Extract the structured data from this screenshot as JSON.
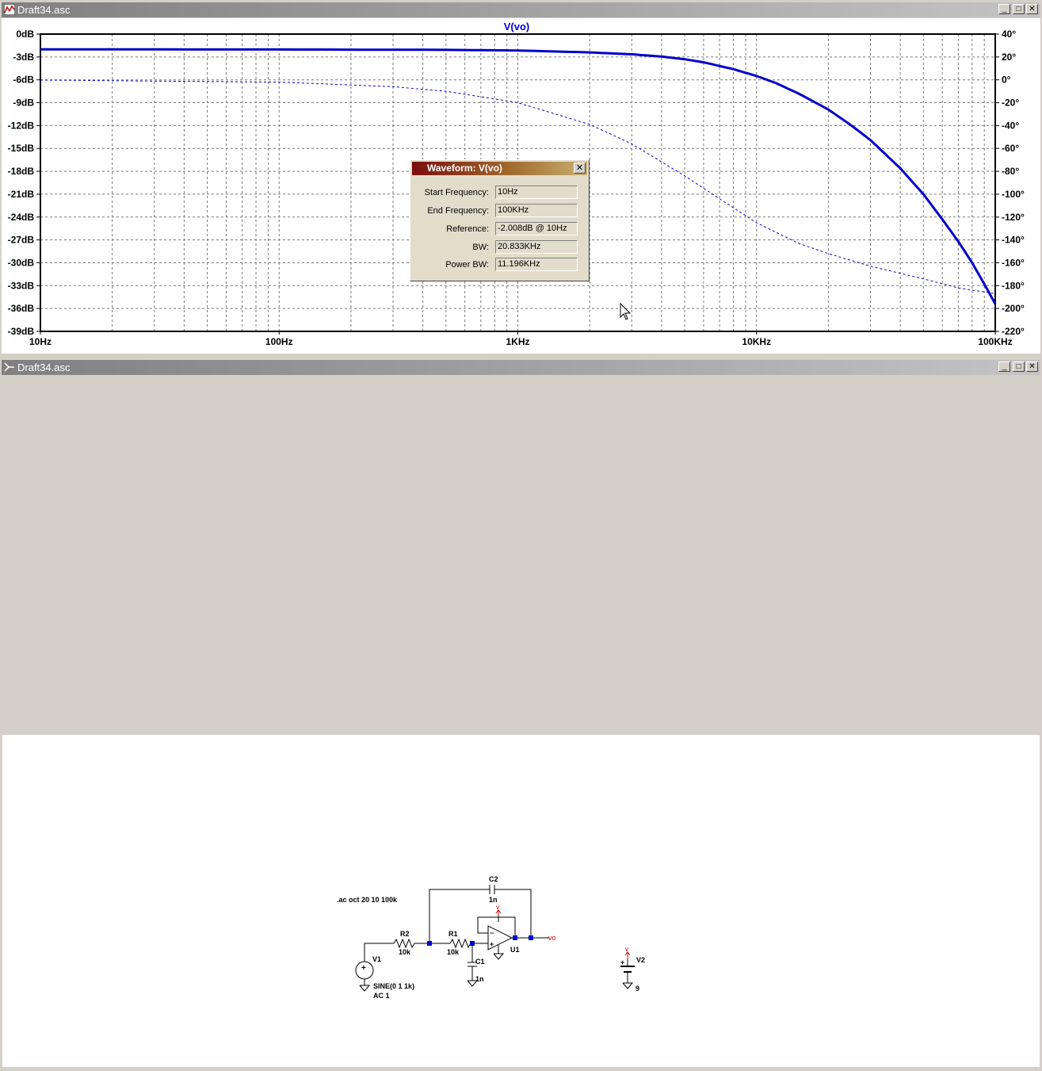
{
  "plot_window": {
    "title": "Draft34.asc",
    "trace_label": "V(vo)"
  },
  "schematic_window": {
    "title": "Draft34.asc"
  },
  "controls": {
    "minimize": "_",
    "maximize": "□",
    "close": "✕"
  },
  "chart_data": {
    "type": "line",
    "title": "V(vo)",
    "xscale": "log",
    "xlim": [
      10,
      100000
    ],
    "x_ticks": [
      "10Hz",
      "100Hz",
      "1KHz",
      "10KHz",
      "100KHz"
    ],
    "y_left_ticks": [
      "0dB",
      "-3dB",
      "-6dB",
      "-9dB",
      "-12dB",
      "-15dB",
      "-18dB",
      "-21dB",
      "-24dB",
      "-27dB",
      "-30dB",
      "-33dB",
      "-36dB",
      "-39dB"
    ],
    "ylim_left": [
      -39,
      0
    ],
    "y_right_ticks": [
      "40°",
      "20°",
      "0°",
      "-20°",
      "-40°",
      "-60°",
      "-80°",
      "-100°",
      "-120°",
      "-140°",
      "-160°",
      "-180°",
      "-200°",
      "-220°"
    ],
    "ylim_right": [
      -220,
      40
    ],
    "grid": true,
    "series": [
      {
        "style": "solid",
        "axis": "left",
        "color": "#0000cc",
        "x": [
          10,
          100,
          500,
          1000,
          2000,
          3000,
          4000,
          5000,
          6000,
          8000,
          10000,
          12000,
          15000,
          20000,
          25000,
          30000,
          40000,
          50000,
          60000,
          70000,
          80000,
          90000,
          100000
        ],
        "y": [
          -2.0,
          -2.02,
          -2.07,
          -2.15,
          -2.4,
          -2.65,
          -2.95,
          -3.3,
          -3.7,
          -4.6,
          -5.5,
          -6.4,
          -7.8,
          -9.9,
          -12.0,
          -13.9,
          -17.6,
          -21.0,
          -24.3,
          -27.2,
          -30.0,
          -32.8,
          -35.4
        ]
      },
      {
        "style": "dashed",
        "axis": "right",
        "color": "#0000cc",
        "x": [
          10,
          100,
          300,
          500,
          1000,
          2000,
          3000,
          5000,
          7000,
          10000,
          15000,
          20000,
          30000,
          50000,
          70000,
          100000
        ],
        "y": [
          -0.2,
          -2,
          -6,
          -10,
          -20,
          -39,
          -56,
          -84,
          -104,
          -125,
          -143,
          -152,
          -163,
          -174,
          -182,
          -187
        ]
      }
    ]
  },
  "dialog": {
    "title": "Waveform: V(vo)",
    "close": "✕",
    "rows": [
      {
        "label": "Start Frequency:",
        "value": "10Hz"
      },
      {
        "label": "End Frequency:",
        "value": "100KHz"
      },
      {
        "label": "Reference:",
        "value": "-2.008dB @ 10Hz"
      },
      {
        "label": "BW:",
        "value": "20.833KHz"
      },
      {
        "label": "Power BW:",
        "value": "11.196KHz"
      }
    ]
  },
  "schematic": {
    "directive": ".ac oct 20 10 100k",
    "c2_name": "C2",
    "c2_value": "1n",
    "r2_name": "R2",
    "r2_value": "10k",
    "r1_name": "R1",
    "r1_value": "10k",
    "c1_name": "C1",
    "c1_value": "1n",
    "u1_name": "U1",
    "out_label": "vo",
    "v1_name": "V1",
    "v1_value": "SINE(0 1 1k)",
    "v1_ac": "AC 1",
    "v2_name": "V2",
    "v2_value": "9",
    "supply_label": "v",
    "plus": "+",
    "minus": "−"
  }
}
